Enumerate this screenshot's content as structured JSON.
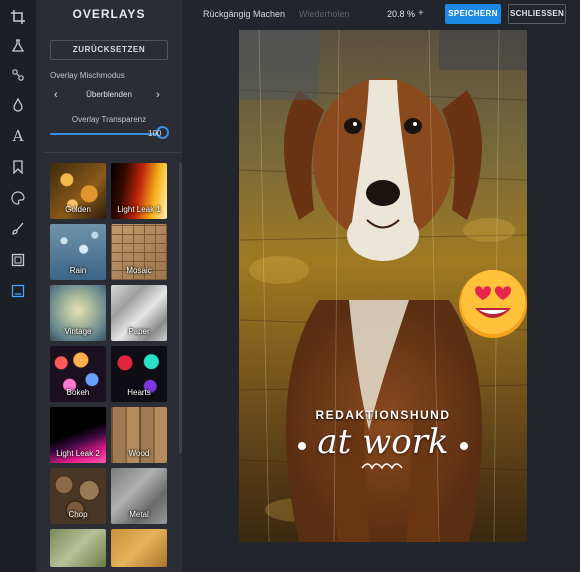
{
  "panel": {
    "title": "OVERLAYS",
    "reset_label": "ZURÜCKSETZEN",
    "blend_mode_label": "Overlay Mischmodus",
    "blend_mode_value": "Überblenden",
    "transparency_label": "Overlay Transparenz",
    "transparency_value": "100",
    "overlays": [
      {
        "label": "Golden"
      },
      {
        "label": "Light Leak 1"
      },
      {
        "label": "Rain"
      },
      {
        "label": "Mosaic"
      },
      {
        "label": "Vintage"
      },
      {
        "label": "Paper"
      },
      {
        "label": "Bokeh"
      },
      {
        "label": "Hearts"
      },
      {
        "label": "Light Leak 2"
      },
      {
        "label": "Wood"
      },
      {
        "label": "Chop"
      },
      {
        "label": "Metal"
      },
      {
        "label": ""
      },
      {
        "label": ""
      }
    ]
  },
  "toolbar": {
    "undo_label": "Rückgängig Machen",
    "redo_label": "Wiederholen",
    "zoom_value": "20.8 %",
    "zoom_plus": "+",
    "save_label": "SPEICHERN",
    "close_label": "SCHLIESSEN"
  },
  "canvas": {
    "caption_top": "REDAKTIONSHUND",
    "caption_script": "at work"
  },
  "rail_icons": [
    "crop-icon",
    "filter-icon",
    "adjust-icon",
    "drop-icon",
    "text-icon",
    "bookmark-icon",
    "palette-icon",
    "brush-icon",
    "frame-icon",
    "overlay-icon"
  ],
  "colors": {
    "accent": "#1e88e5",
    "panel_bg": "#2a2d33",
    "rail_bg": "#1c1f24"
  }
}
